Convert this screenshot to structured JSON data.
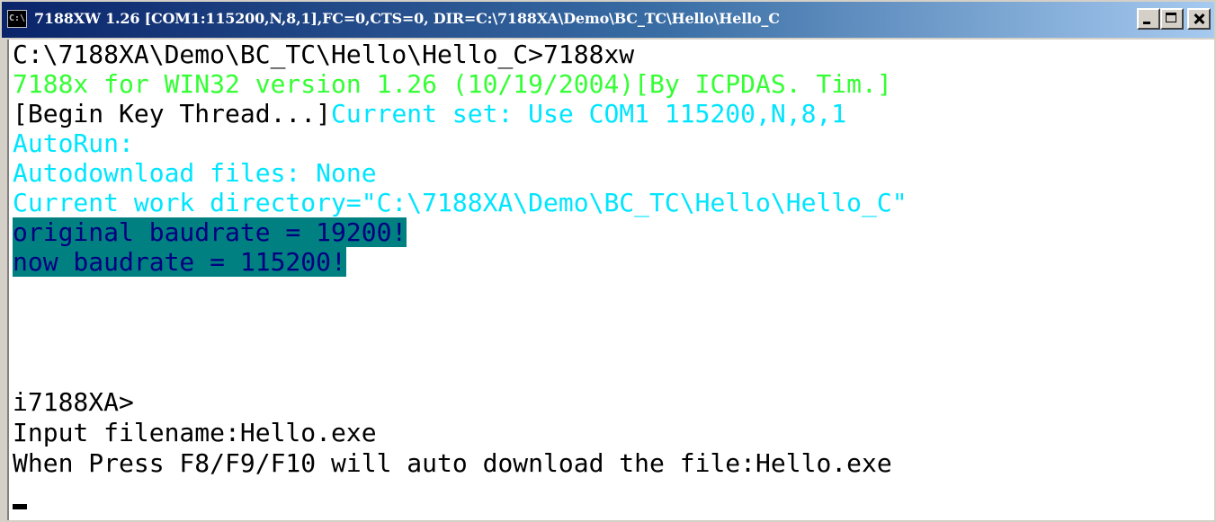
{
  "window": {
    "title": "7188XW 1.26 [COM1:115200,N,8,1],FC=0,CTS=0, DIR=C:\\7188XA\\Demo\\BC_TC\\Hello\\Hello_C",
    "icon_label": "C:\\",
    "icon": "console-icon",
    "controls": {
      "minimize": "minimize-icon",
      "maximize": "maximize-icon",
      "close": "close-icon"
    }
  },
  "console": {
    "lines": [
      {
        "text": "C:\\7188XA\\Demo\\BC_TC\\Hello\\Hello_C>7188xw",
        "color": "#000000"
      },
      {
        "text": "7188x for WIN32 version 1.26 (10/19/2004)[By ICPDAS. Tim.]",
        "color": "#33ff33"
      },
      {
        "segments": [
          {
            "text": "[Begin Key Thread...]",
            "color": "#000000"
          },
          {
            "text": "Current set: Use COM1 115200,N,8,1",
            "color": "#00e5ff"
          }
        ]
      },
      {
        "text": "AutoRun:",
        "color": "#00e5ff"
      },
      {
        "text": "Autodownload files: None",
        "color": "#00e5ff"
      },
      {
        "text": "Current work directory=\"C:\\7188XA\\Demo\\BC_TC\\Hello\\Hello_C\"",
        "color": "#00e5ff"
      },
      {
        "text": "original baudrate = 19200!",
        "highlight": true
      },
      {
        "text": "now baudrate = 115200!",
        "highlight": true
      },
      {
        "text": ""
      },
      {
        "text": ""
      },
      {
        "text": "i7188XA>",
        "color": "#000000"
      },
      {
        "text": "Input filename:Hello.exe",
        "color": "#000000"
      },
      {
        "text": "When Press F8/F9/F10 will auto download the file:Hello.exe",
        "color": "#000000"
      }
    ]
  },
  "colors": {
    "title_bar_start": "#0a246a",
    "title_bar_end": "#a6caf0",
    "highlight_bg": "#008080",
    "highlight_fg": "#000080",
    "green_text": "#33ff33",
    "cyan_text": "#00e5ff"
  }
}
